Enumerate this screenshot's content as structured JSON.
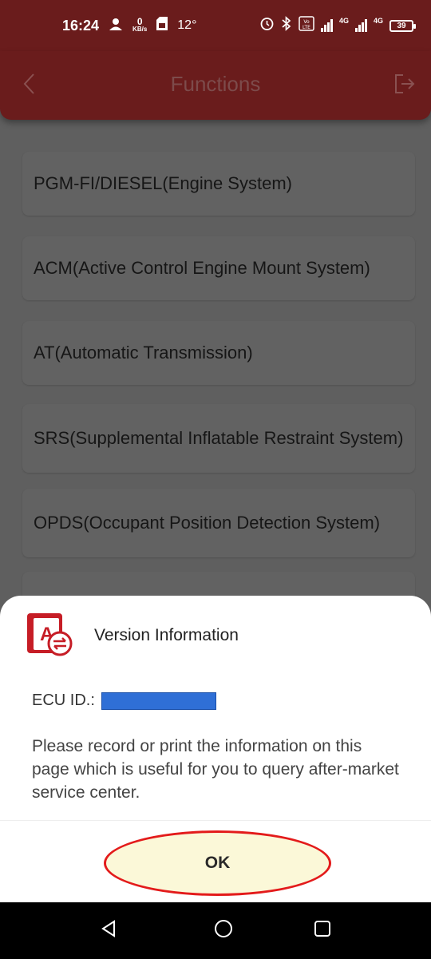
{
  "status_bar": {
    "time": "16:24",
    "net_speed_value": "0",
    "net_speed_unit": "KB/s",
    "temperature": "12°",
    "network_1": "4G",
    "network_2": "4G",
    "volte": "VoLTE",
    "battery": "39"
  },
  "header": {
    "title": "Functions",
    "back_icon": "chevron-left-icon",
    "exit_icon": "exit-icon"
  },
  "functions": [
    "PGM-FI/DIESEL(Engine System)",
    "ACM(Active Control Engine Mount System)",
    "AT(Automatic Transmission)",
    "SRS(Supplemental Inflatable Restraint System)",
    "OPDS(Occupant Position Detection System)"
  ],
  "dialog": {
    "title": "Version Information",
    "ecu_label": "ECU ID.:",
    "message": "Please record or print the information on this page which is useful for you to query after-market service center.",
    "ok_label": "OK"
  },
  "colors": {
    "header_bg": "#6a1c1c",
    "overlay_bg": "#5f5f5f",
    "highlight_outline": "#e31b1b",
    "highlight_fill": "#fbf8d8",
    "ecu_redaction": "#2f6fd6"
  },
  "nav_bar": {
    "back_icon": "triangle-back-icon",
    "home_icon": "circle-home-icon",
    "recents_icon": "square-recents-icon"
  }
}
